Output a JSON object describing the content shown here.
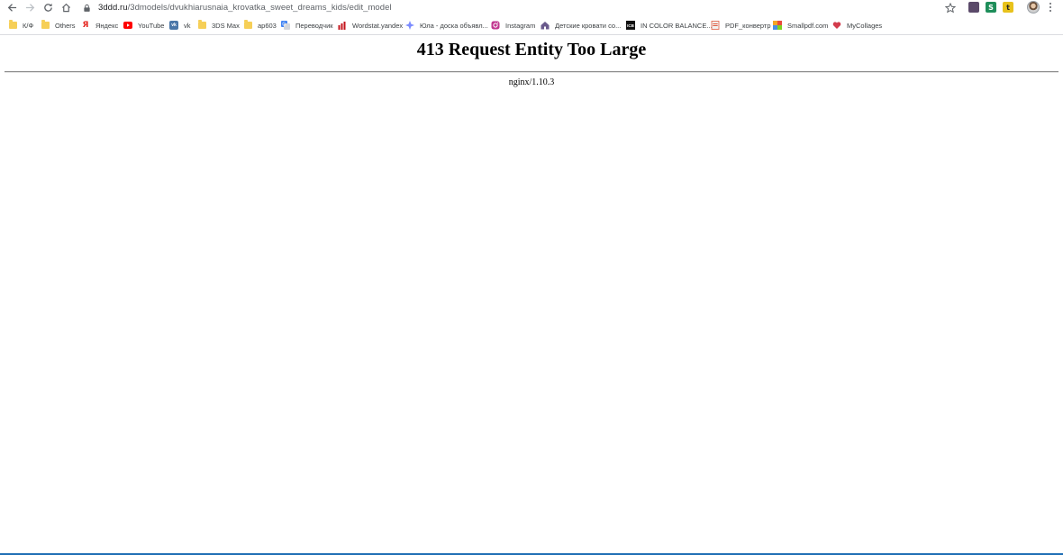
{
  "toolbar": {
    "url_host": "3ddd.ru",
    "url_path": "/3dmodels/dvukhiarusnaia_krovatka_sweet_dreams_kids/edit_model",
    "extensions": [
      {
        "name": "photo-extension-icon",
        "letter": "",
        "color": "#5b4a6a"
      },
      {
        "name": "s-extension-icon",
        "letter": "S",
        "color": "#1e8e5a"
      },
      {
        "name": "t-extension-icon",
        "letter": "t",
        "color": "#e8c21c"
      }
    ]
  },
  "bookmarks": [
    {
      "label": "К/Ф",
      "icon": "folder-icon"
    },
    {
      "label": "Others",
      "icon": "folder-icon"
    },
    {
      "label": "Яндекс",
      "icon": "yandex-icon"
    },
    {
      "label": "YouTube",
      "icon": "youtube-icon"
    },
    {
      "label": "vk",
      "icon": "vk-icon"
    },
    {
      "label": "3DS Max",
      "icon": "folder-icon"
    },
    {
      "label": "ар603",
      "icon": "folder-icon"
    },
    {
      "label": "Переводчик",
      "icon": "translate-icon"
    },
    {
      "label": "Wordstat.yandex",
      "icon": "wordstat-icon"
    },
    {
      "label": "Юла - доска объявл...",
      "icon": "youla-icon"
    },
    {
      "label": "Instagram",
      "icon": "instagram-icon"
    },
    {
      "label": "Детские кровати со...",
      "icon": "house-icon"
    },
    {
      "label": "IN COLOR BALANCE...",
      "icon": "icb-icon"
    },
    {
      "label": "PDF_конвертр",
      "icon": "pdf-icon"
    },
    {
      "label": "Smallpdf.com",
      "icon": "smallpdf-icon"
    },
    {
      "label": "MyCollages",
      "icon": "heart-icon"
    }
  ],
  "page": {
    "title": "413 Request Entity Too Large",
    "server": "nginx/1.10.3"
  }
}
